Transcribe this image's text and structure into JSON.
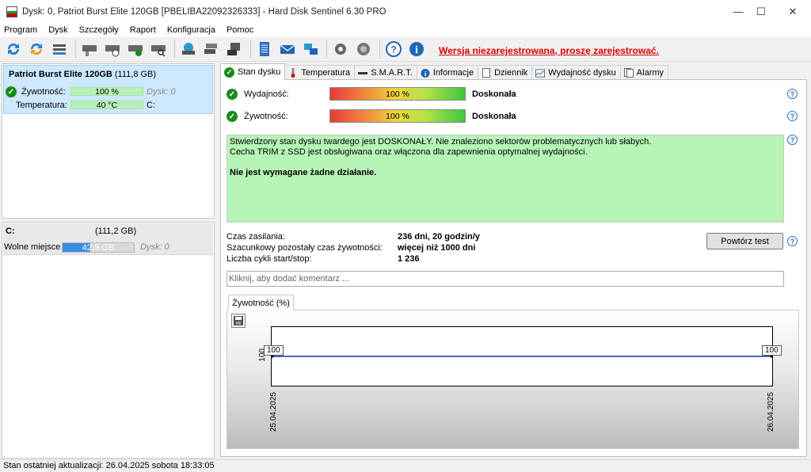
{
  "window": {
    "title": "Dysk: 0, Patriot Burst Elite  120GB [PBELIBA22092326333]  -  Hard Disk Sentinel 6.30 PRO",
    "controls": {
      "minimize": "—",
      "maximize": "☐",
      "close": "✕"
    }
  },
  "menu": [
    "Program",
    "Dysk",
    "Szczegóły",
    "Raport",
    "Konfiguracja",
    "Pomoc"
  ],
  "toolbar": {
    "unregistered_text": "Wersja niezarejestrowana, proszę zarejestrować.",
    "buttons": [
      "refresh-icon",
      "refresh-all-icon",
      "disk-list-icon",
      "disk-icon",
      "disk-clock-icon",
      "disk-check-icon",
      "disk-search-icon",
      "network-drive-icon",
      "disk-stack-icon",
      "external-drive-icon",
      "report-icon",
      "email-icon",
      "network-icon",
      "settings-icon",
      "sound-icon",
      "help-icon",
      "info-icon"
    ]
  },
  "left_panel": {
    "disk": {
      "name": "Patriot Burst Elite  120GB",
      "size": "(111,8 GB)",
      "health_label": "Żywotność:",
      "health_value": "100 %",
      "health_disk": "Dysk: 0",
      "temp_label": "Temperatura:",
      "temp_value": "40 °C",
      "temp_drive": "C:"
    },
    "volume": {
      "letter": "C:",
      "size": "(111,2 GB)",
      "free_label": "Wolne miejsce",
      "free_value": "42,9 GB",
      "free_fraction": 0.386,
      "disk_ref": "Dysk: 0"
    }
  },
  "tabs": [
    {
      "label": "Stan dysku",
      "icon": "check-icon",
      "active": true
    },
    {
      "label": "Temperatura",
      "icon": "thermometer-icon",
      "active": false
    },
    {
      "label": "S.M.A.R.T.",
      "icon": "dash-icon",
      "active": false
    },
    {
      "label": "Informacje",
      "icon": "info-icon",
      "active": false
    },
    {
      "label": "Dziennik",
      "icon": "page-icon",
      "active": false
    },
    {
      "label": "Wydajność dysku",
      "icon": "chart-icon",
      "active": false
    },
    {
      "label": "Alarmy",
      "icon": "pages-icon",
      "active": false
    }
  ],
  "status": {
    "performance_label": "Wydajność:",
    "performance_value": "100 %",
    "performance_rating": "Doskonała",
    "health_label": "Żywotność:",
    "health_value": "100 %",
    "health_rating": "Doskonała",
    "message_line1": "Stwierdzony stan dysku twardego jest DOSKONAŁY. Nie znaleziono sektorów problematycznych lub słabych.",
    "message_line2": "Cecha TRIM z SSD jest obsługiwana oraz włączona dla zapewnienia optymalnej wydajności.",
    "message_bold": "Nie jest wymagane żadne działanie.",
    "power_on_label": "Czas zasilania:",
    "power_on_value": "236 dni, 20 godzin/y",
    "remaining_label": "Szacunkowy pozostały czas żywotności:",
    "remaining_value": "więcej niż 1000 dni",
    "cycles_label": "Liczba cykli start/stop:",
    "cycles_value": "1 236",
    "retest_button": "Powtórz test",
    "comment_placeholder": "Kliknij, aby dodać komentarz ..."
  },
  "history": {
    "tab_label": "Żywotność (%)",
    "y_axis_tick": "100",
    "points": [
      {
        "date": "25.04.2025",
        "value": "100"
      },
      {
        "date": "26.04.2025",
        "value": "100"
      }
    ],
    "line_color": "#1c2fb8"
  },
  "statusbar": {
    "text": "Stan ostatniej aktualizacji: 26.04.2025 sobota 18:33:05"
  }
}
